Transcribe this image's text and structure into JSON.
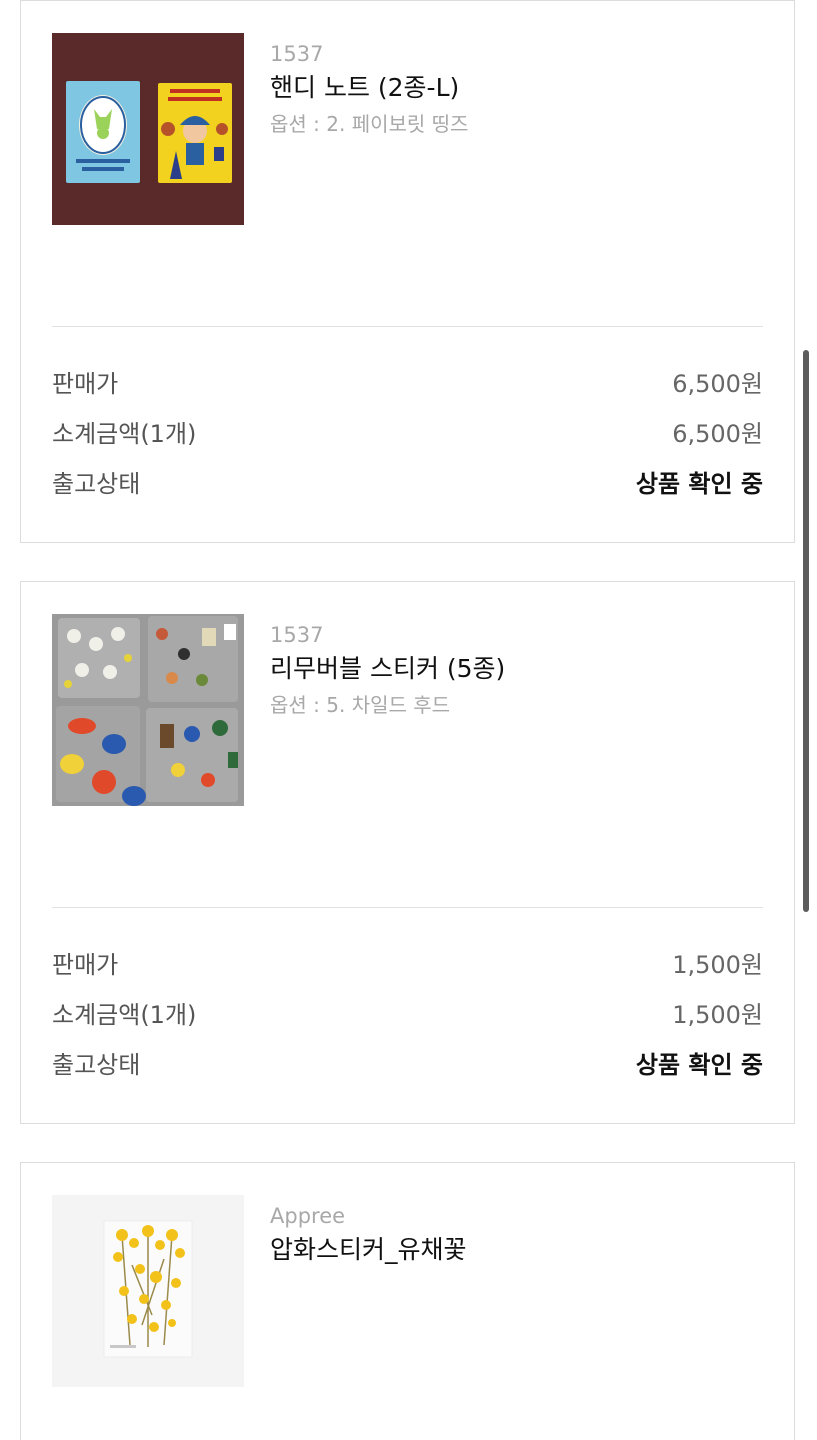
{
  "items": [
    {
      "brand": "1537",
      "name": "핸디 노트 (2종-L)",
      "option": "옵션 : 2. 페이보릿 띵즈",
      "rows": [
        {
          "label": "판매가",
          "value": "6,500원"
        },
        {
          "label": "소계금액(1개)",
          "value": "6,500원"
        },
        {
          "label": "출고상태",
          "value": "상품 확인 중"
        }
      ]
    },
    {
      "brand": "1537",
      "name": "리무버블 스티커 (5종)",
      "option": "옵션 : 5. 차일드 후드",
      "rows": [
        {
          "label": "판매가",
          "value": "1,500원"
        },
        {
          "label": "소계금액(1개)",
          "value": "1,500원"
        },
        {
          "label": "출고상태",
          "value": "상품 확인 중"
        }
      ]
    },
    {
      "brand": "Appree",
      "name": "압화스티커_유채꽃"
    }
  ],
  "colors": {
    "border": "#dcdcdc",
    "muted_text": "#a8a8a8",
    "primary_text": "#111111",
    "scrollbar": "#5c5c5c"
  }
}
